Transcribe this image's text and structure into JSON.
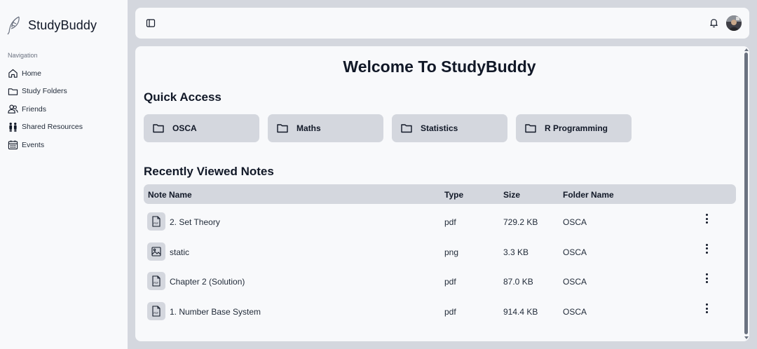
{
  "brand": {
    "name": "StudyBuddy",
    "logo_icon": "feather-icon"
  },
  "sidebar": {
    "heading": "Navigation",
    "items": [
      {
        "label": "Home",
        "icon": "home-icon"
      },
      {
        "label": "Study Folders",
        "icon": "folder-icon"
      },
      {
        "label": "Friends",
        "icon": "users-icon"
      },
      {
        "label": "Shared Resources",
        "icon": "people-icon"
      },
      {
        "label": "Events",
        "icon": "calendar-icon"
      }
    ]
  },
  "topbar": {
    "toggle_icon": "sidebar-toggle-icon",
    "bell_icon": "bell-icon",
    "avatar": "user-avatar"
  },
  "main": {
    "title": "Welcome To StudyBuddy",
    "quick_access": {
      "title": "Quick Access",
      "folders": [
        "OSCA",
        "Maths",
        "Statistics",
        "R Programming"
      ]
    },
    "recent": {
      "title": "Recently Viewed Notes",
      "columns": [
        "Note Name",
        "Type",
        "Size",
        "Folder Name"
      ],
      "rows": [
        {
          "name": "2. Set Theory",
          "type": "pdf",
          "size": "729.2 KB",
          "folder": "OSCA",
          "icon": "pdf-file-icon"
        },
        {
          "name": "static",
          "type": "png",
          "size": "3.3 KB",
          "folder": "OSCA",
          "icon": "image-file-icon"
        },
        {
          "name": "Chapter 2 (Solution)",
          "type": "pdf",
          "size": "87.0 KB",
          "folder": "OSCA",
          "icon": "pdf-file-icon"
        },
        {
          "name": "1. Number Base System",
          "type": "pdf",
          "size": "914.4 KB",
          "folder": "OSCA",
          "icon": "pdf-file-icon"
        }
      ]
    }
  },
  "colors": {
    "accent_grey": "#d4d7de",
    "panel": "#f8f9fb",
    "text": "#111827"
  }
}
